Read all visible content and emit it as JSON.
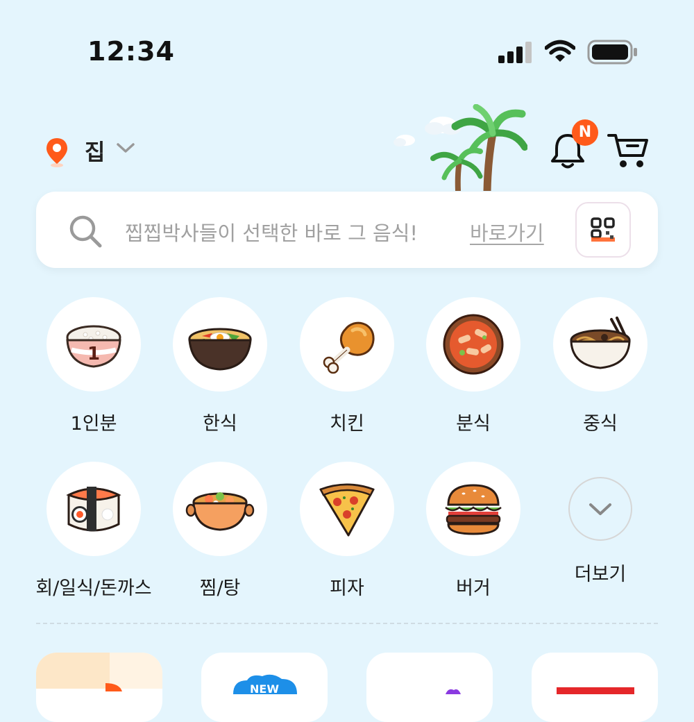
{
  "status_bar": {
    "time": "12:34"
  },
  "header": {
    "location": "집",
    "notification_badge": "N",
    "accent_color": "#ff5a1a"
  },
  "search": {
    "placeholder": "찝찝박사들이 선택한 바로 그 음식!",
    "link_label": "바로가기"
  },
  "categories": [
    {
      "label": "1인분",
      "icon": "rice-bowl-icon"
    },
    {
      "label": "한식",
      "icon": "bibimbap-icon"
    },
    {
      "label": "치킨",
      "icon": "chicken-leg-icon"
    },
    {
      "label": "분식",
      "icon": "tteokbokki-icon"
    },
    {
      "label": "중식",
      "icon": "noodle-bowl-icon"
    },
    {
      "label": "회/일식/돈까스",
      "icon": "sushi-icon"
    },
    {
      "label": "찜/탕",
      "icon": "stew-pot-icon"
    },
    {
      "label": "피자",
      "icon": "pizza-slice-icon"
    },
    {
      "label": "버거",
      "icon": "burger-icon"
    },
    {
      "label": "더보기",
      "icon": "chevron-down-icon"
    }
  ],
  "banners": [
    {
      "icon": "banner-orange-logo"
    },
    {
      "badge": "NEW"
    },
    {
      "icon": "banner-purple-logo"
    },
    {
      "icon": "banner-red-logo"
    }
  ]
}
